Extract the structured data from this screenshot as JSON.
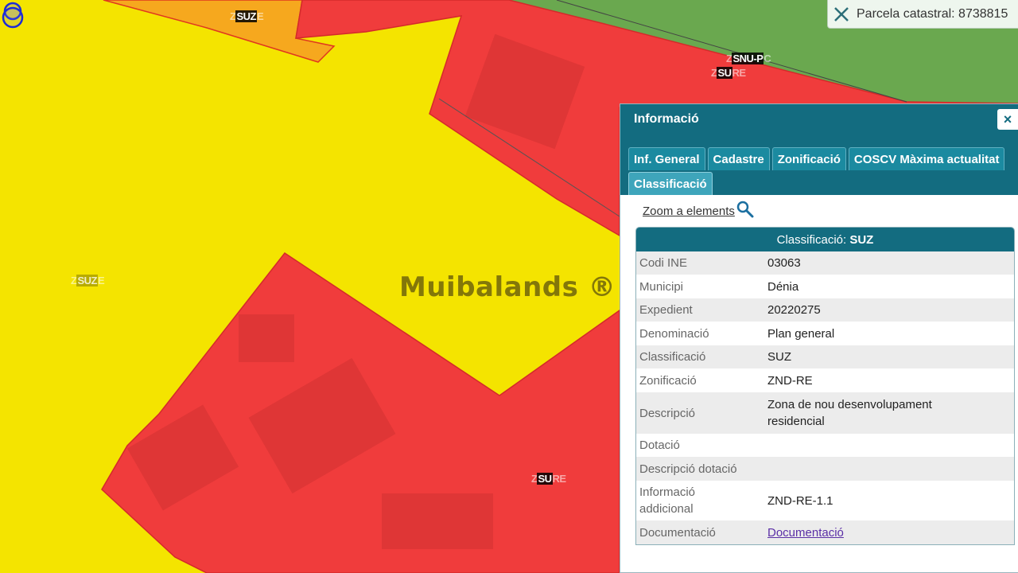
{
  "parcela": {
    "label": "Parcela catastral: 8738815"
  },
  "map": {
    "watermark": "Muibalands ®",
    "labels": [
      {
        "pre": "Z",
        "main": "SUZ",
        "post": "E"
      },
      {
        "pre": "Z",
        "main": "SNU-P",
        "post": "C"
      },
      {
        "pre": "Z",
        "main": "SU",
        "post": "RE"
      },
      {
        "pre": "Z",
        "main": "SUZ",
        "post": "E"
      },
      {
        "pre": "Z",
        "main": "SU",
        "post": "RE"
      }
    ],
    "colors": {
      "yellow": "#f4e400",
      "red": "#f03c3c",
      "green": "#6aa84f",
      "orange": "#f6a81e"
    }
  },
  "info": {
    "title": "Informació",
    "close_label": "×",
    "tabs": [
      "Inf. General",
      "Cadastre",
      "Zonificació",
      "COSCV Màxima actualitat",
      "Classificació"
    ],
    "active_tab": "Classificació",
    "zoom_link": "Zoom a elements",
    "table": {
      "heading_prefix": "Classificació: ",
      "heading_value": "SUZ",
      "rows": [
        {
          "key": "Codi INE",
          "value": "03063"
        },
        {
          "key": "Municipi",
          "value": "Dénia"
        },
        {
          "key": "Expedient",
          "value": "20220275"
        },
        {
          "key": "Denominació",
          "value": "Plan general"
        },
        {
          "key": "Classificació",
          "value": "SUZ"
        },
        {
          "key": "Zonificació",
          "value": "ZND-RE"
        },
        {
          "key": "Descripció",
          "value": "Zona de nou desenvolupament residencial"
        },
        {
          "key": "Dotació",
          "value": ""
        },
        {
          "key": "Descripció dotació",
          "value": ""
        },
        {
          "key": "Informació addicional",
          "value": "ZND-RE-1.1"
        },
        {
          "key": "Documentació",
          "value": "Documentació"
        }
      ]
    }
  }
}
